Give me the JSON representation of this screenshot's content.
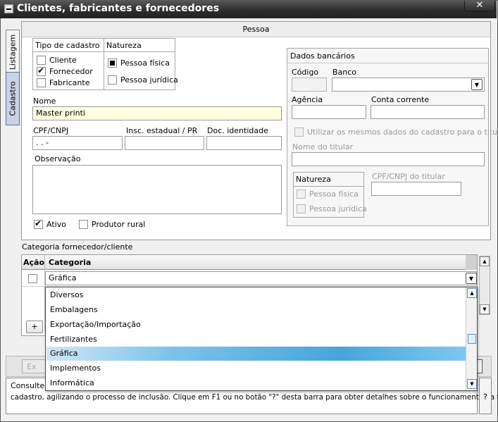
{
  "window": {
    "title": "Clientes, fabricantes e fornecedores",
    "close_label": "✕"
  },
  "vtabs": {
    "listagem": "Listagem",
    "cadastro": "Cadastro"
  },
  "pessoa_header": "Pessoa",
  "tipo_cadastro": {
    "title": "Tipo de cadastro",
    "items": [
      {
        "label": "Cliente",
        "checked": false
      },
      {
        "label": "Fornecedor",
        "checked": true
      },
      {
        "label": "Fabricante",
        "checked": false
      }
    ]
  },
  "natureza": {
    "title": "Natureza",
    "items": [
      {
        "label": "Pessoa física",
        "checked": true
      },
      {
        "label": "Pessoa jurídica",
        "checked": false
      }
    ]
  },
  "form": {
    "nome_label": "Nome",
    "nome_value": "Master printi",
    "cpf_label": "CPF/CNPJ",
    "cpf_value": " .   .   -",
    "insc_label": "Insc. estadual / PR",
    "insc_value": "",
    "doc_label": "Doc. identidade",
    "doc_value": "",
    "obs_label": "Observação",
    "obs_value": "",
    "ativo_label": "Ativo",
    "ativo_checked": true,
    "produtor_label": "Produtor rural",
    "produtor_checked": false
  },
  "dados_bancarios": {
    "title": "Dados bancários",
    "codigo_label": "Código",
    "banco_label": "Banco",
    "agencia_label": "Agência",
    "conta_label": "Conta corrente",
    "mesmos_dados_label": "Utilizar os mesmos dados do cadastro para o titular",
    "nome_titular_label": "Nome do titular",
    "natureza_title": "Natureza",
    "pf_label": "Pessoa física",
    "pj_label": "Pessoa jurídica",
    "cpf_titular_label": "CPF/CNPJ do titular"
  },
  "categoria": {
    "section_label": "Categoria fornecedor/cliente",
    "col_acao": "Ação",
    "col_categoria": "Categoria",
    "row_value": "Gráfica",
    "add_label": "+",
    "options": [
      "Diversos",
      "Embalagens",
      "Exportação/Importação",
      "Fertilizantes",
      "Gráfica",
      "Implementos",
      "Informática"
    ],
    "selected": "Gráfica"
  },
  "bottom": {
    "partial_btn": "Ex"
  },
  "message": {
    "line1": "Consulte e",
    "line2": "cadastro, agilizando o processo de inclusão. Clique em F1 ou no botão \"?\" desta barra para obter detalhes sobre o funcionamento da tela.",
    "help": "?"
  },
  "colors": {
    "accent": "#47a5db",
    "titlebar": "#2e2e2e",
    "nome_bg": "#ffffe0"
  }
}
